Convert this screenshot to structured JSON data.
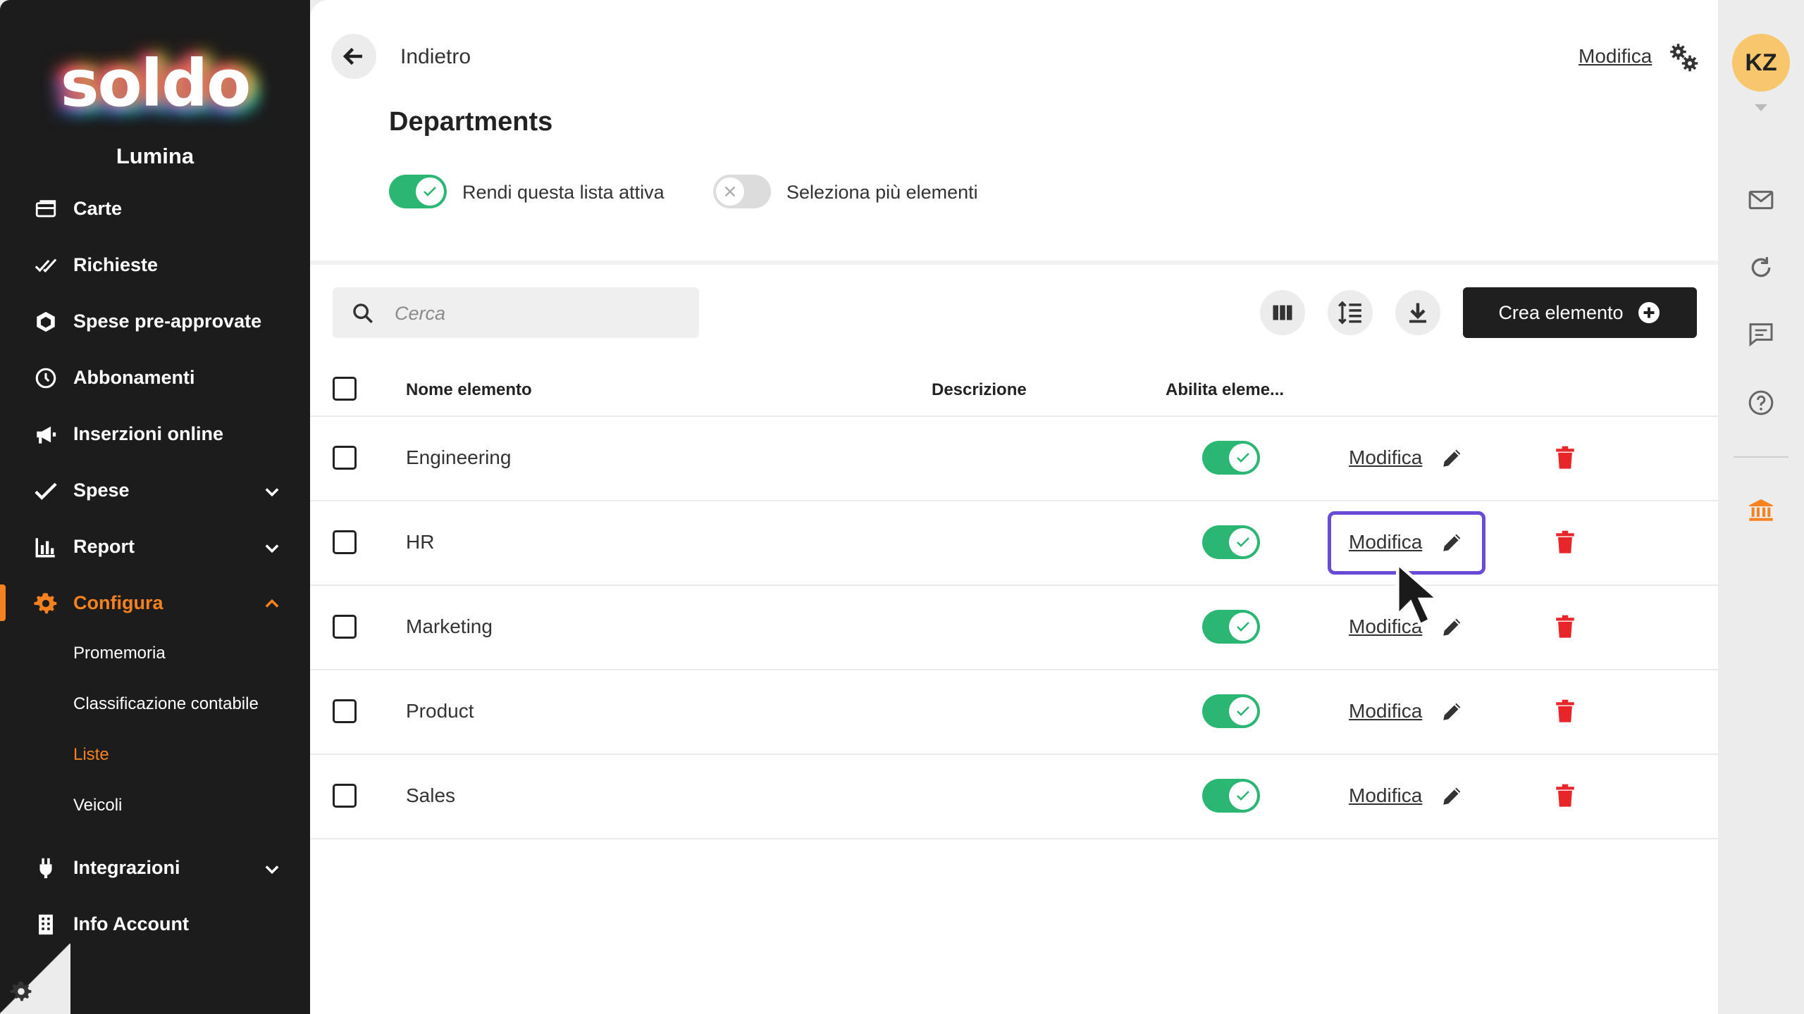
{
  "sidebar": {
    "logo_text": "soldo",
    "company": "Lumina",
    "items": [
      {
        "label": "Carte",
        "icon": "cards-icon"
      },
      {
        "label": "Richieste",
        "icon": "double-check-icon"
      },
      {
        "label": "Spese pre-approvate",
        "icon": "hexagon-icon"
      },
      {
        "label": "Abbonamenti",
        "icon": "clock-icon"
      },
      {
        "label": "Inserzioni online",
        "icon": "megaphone-icon"
      },
      {
        "label": "Spese",
        "icon": "check-icon",
        "chevron": "down"
      },
      {
        "label": "Report",
        "icon": "bar-chart-icon",
        "chevron": "down"
      },
      {
        "label": "Configura",
        "icon": "gear-icon",
        "chevron": "up",
        "active": true
      },
      {
        "label": "Integrazioni",
        "icon": "plug-icon",
        "chevron": "down"
      },
      {
        "label": "Info Account",
        "icon": "building-icon"
      }
    ],
    "sub_items": [
      {
        "label": "Promemoria"
      },
      {
        "label": "Classificazione contabile"
      },
      {
        "label": "Liste",
        "active": true
      },
      {
        "label": "Veicoli"
      }
    ]
  },
  "header": {
    "back_label": "Indietro",
    "edit_label": "Modifica",
    "title": "Departments",
    "toggle_active_label": "Rendi questa lista attiva",
    "toggle_active": true,
    "toggle_multi_label": "Seleziona più elementi",
    "toggle_multi": false
  },
  "toolbar": {
    "search_placeholder": "Cerca",
    "create_label": "Crea elemento"
  },
  "table": {
    "columns": [
      "Nome elemento",
      "Descrizione",
      "Abilita eleme..."
    ],
    "edit_label": "Modifica",
    "rows": [
      {
        "name": "Engineering",
        "description": "",
        "enabled": true
      },
      {
        "name": "HR",
        "description": "",
        "enabled": true
      },
      {
        "name": "Marketing",
        "description": "",
        "enabled": true
      },
      {
        "name": "Product",
        "description": "",
        "enabled": true
      },
      {
        "name": "Sales",
        "description": "",
        "enabled": true
      }
    ]
  },
  "rail": {
    "avatar_initials": "KZ",
    "icons": [
      "mail-icon",
      "refresh-icon",
      "chat-icon",
      "help-icon",
      "bank-icon"
    ]
  },
  "colors": {
    "accent_orange": "#f5821f",
    "toggle_green": "#2bb673",
    "delete_red": "#e8262a",
    "focus_purple": "#6a4bd6",
    "avatar_yellow": "#f8c66c"
  }
}
